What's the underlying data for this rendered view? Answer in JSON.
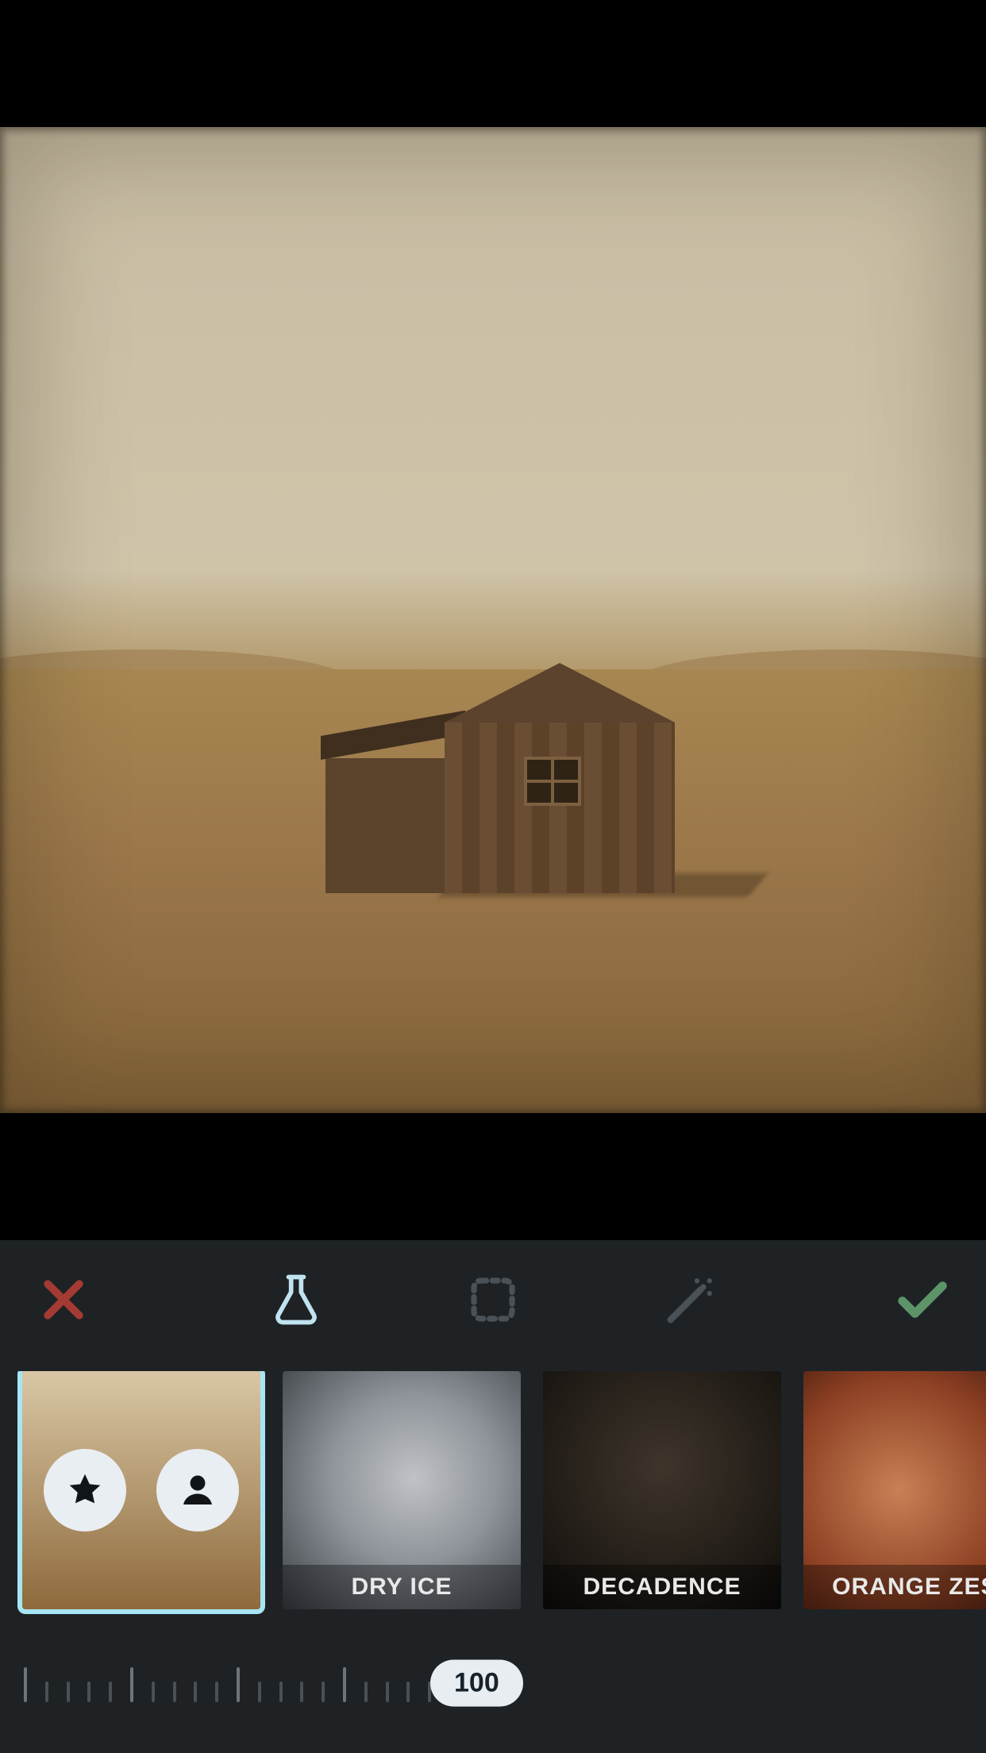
{
  "toolbar": {
    "cancel_icon": "close-icon",
    "confirm_icon": "check-icon",
    "tools": [
      {
        "name": "flask-icon",
        "active": true
      },
      {
        "name": "frame-icon",
        "active": false
      },
      {
        "name": "wand-icon",
        "active": false
      }
    ]
  },
  "filters": [
    {
      "id": "originals",
      "label": "",
      "selected": true
    },
    {
      "id": "dry-ice",
      "label": "DRY ICE",
      "selected": false
    },
    {
      "id": "decadence",
      "label": "DECADENCE",
      "selected": false
    },
    {
      "id": "orange-zest",
      "label": "ORANGE ZEST",
      "selected": false
    }
  ],
  "slider": {
    "value": 100,
    "display": "100"
  },
  "colors": {
    "panel_bg": "#1e2225",
    "accent_selected": "#a8e5f4",
    "cancel": "#a43a34",
    "confirm": "#5c9468",
    "tool_active": "#bfe3ef",
    "tool_inactive": "#4a5257"
  }
}
